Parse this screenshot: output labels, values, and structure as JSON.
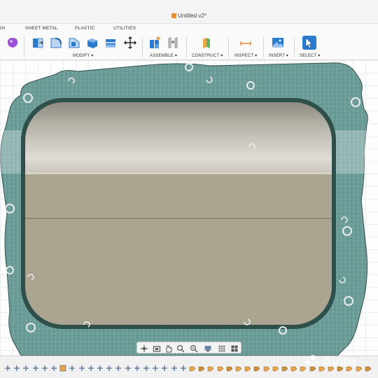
{
  "title_bar": {
    "document_title": "Untitled v2*",
    "doc_icon": "fusion-document-icon"
  },
  "ribbon_tabs": [
    "SH",
    "SHEET METAL",
    "PLASTIC",
    "UTILITIES"
  ],
  "ribbon_groups": {
    "modify": "MODIFY ▾",
    "assemble": "ASSEMBLE ▾",
    "construct": "CONSTRUCT ▾",
    "inspect": "INSPECT ▾",
    "insert": "INSERT ▾",
    "select": "SELECT ▾"
  },
  "ribbon_icons": [
    "form-icon",
    "press-pull-icon",
    "fillet-icon",
    "chamfer-icon",
    "shell-icon",
    "combine-icon",
    "move-icon",
    "new-component-icon",
    "joint-icon",
    "offset-plane-icon",
    "measure-icon",
    "insert-image-icon",
    "select-icon"
  ],
  "nav_bar_icons": [
    "orbit-icon",
    "look-at-icon",
    "pan-icon",
    "zoom-icon",
    "fit-icon",
    "display-settings-icon",
    "grid-settings-icon",
    "viewports-icon"
  ],
  "timeline_icons": [
    "sketch-feature-icon",
    "extrude-feature-icon",
    "body-feature-icon"
  ],
  "watermark": {
    "text": "Avito"
  },
  "colors": {
    "gasket": "#6a9a95",
    "gasket_edge": "#2f4f4b",
    "insert_bottom": "#aba491",
    "insert_top_light": "#d9d7cf",
    "insert_top_dark": "#8e8b82",
    "grid_line": "#e9edf1",
    "blue_accent": "#2a7bd0",
    "orange_accent": "#e98a2c"
  }
}
